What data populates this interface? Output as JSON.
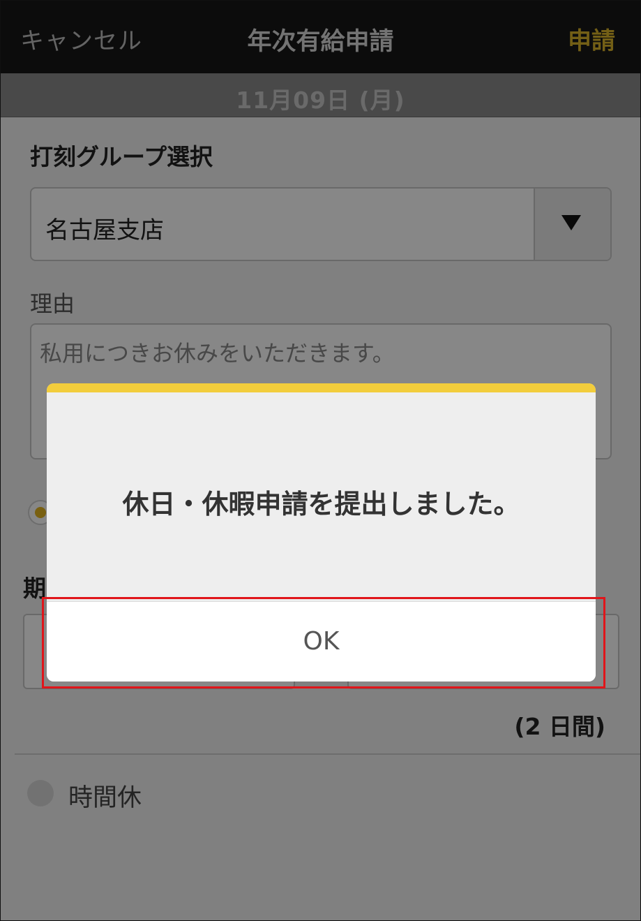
{
  "header": {
    "cancel_label": "キャンセル",
    "title": "年次有給申請",
    "submit_label": "申請"
  },
  "date_bar": {
    "date": "11月09日 (月)"
  },
  "form": {
    "group_section_title": "打刻グループ選択",
    "group_select_value": "名古屋支店",
    "reason_label": "理由",
    "reason_value": "私用につきお休みをいただきます。",
    "period_title": "期",
    "days_label": "(2 日間)",
    "hourly_option_label": "時間休"
  },
  "dialog": {
    "message": "休日・休暇申請を提出しました。",
    "ok_label": "OK"
  },
  "colors": {
    "accent": "#f2cd3c",
    "submit": "#d9b32a",
    "highlight": "#e0151a"
  },
  "icons": {
    "select_arrow": "triangle-down-icon"
  }
}
